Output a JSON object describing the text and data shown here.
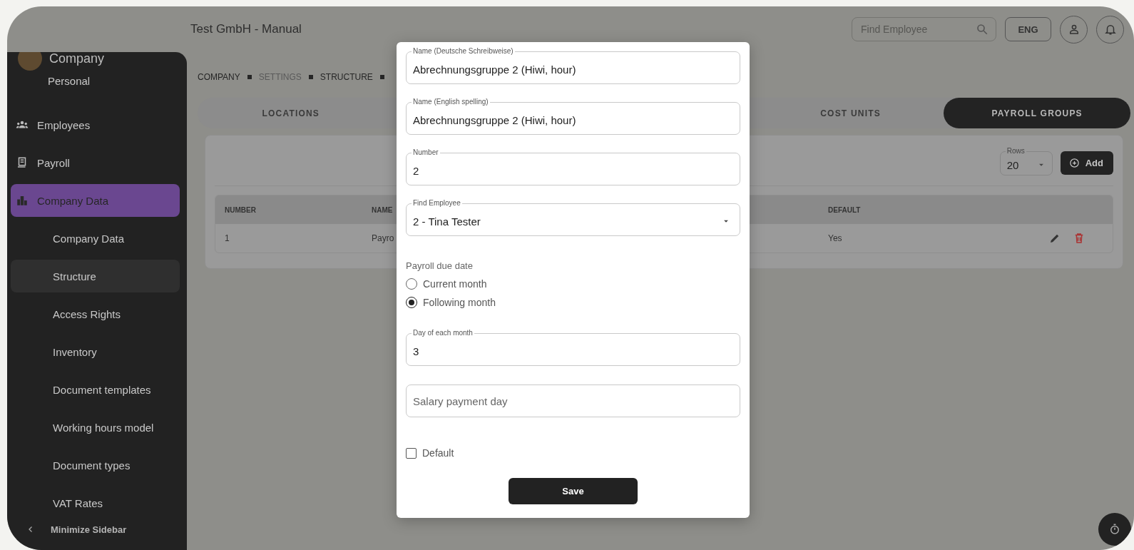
{
  "header": {
    "title": "Test GmbH - Manual",
    "search": {
      "placeholder": "Find Employee"
    },
    "language": "ENG"
  },
  "sidebar": {
    "account": {
      "name": "Company",
      "role": "Personal"
    },
    "items": [
      {
        "label": "Employees",
        "selected": false
      },
      {
        "label": "Payroll",
        "selected": false
      },
      {
        "label": "Company Data",
        "selected": true,
        "children": [
          {
            "label": "Company Data",
            "selected": false
          },
          {
            "label": "Structure",
            "selected": true
          },
          {
            "label": "Access Rights",
            "selected": false
          },
          {
            "label": "Inventory",
            "selected": false
          },
          {
            "label": "Document templates",
            "selected": false
          },
          {
            "label": "Working hours model",
            "selected": false
          },
          {
            "label": "Document types",
            "selected": false
          },
          {
            "label": "VAT Rates",
            "selected": false
          }
        ]
      }
    ],
    "footer": "Minimize Sidebar"
  },
  "breadcrumbs": [
    {
      "label": "COMPANY",
      "muted": false
    },
    {
      "label": "SETTINGS",
      "muted": true
    },
    {
      "label": "STRUCTURE",
      "muted": false
    }
  ],
  "tabs": [
    {
      "label": "LOCATIONS",
      "selected": false
    },
    {
      "label": "COST UNITS",
      "selected": false
    },
    {
      "label": "PAYROLL GROUPS",
      "selected": true
    }
  ],
  "rows_select": {
    "label": "Rows",
    "value": "20"
  },
  "add_button": "Add",
  "table": {
    "columns": [
      "NUMBER",
      "NAME",
      "DEFAULT"
    ],
    "rows": [
      [
        "1",
        "Payro",
        "Yes"
      ]
    ]
  },
  "dialog": {
    "fields": [
      {
        "kind": "text",
        "label": "Name (Deutsche Schreibweise)",
        "value": "Abrechnungsgruppe 2 (Hiwi, hour)"
      },
      {
        "kind": "text",
        "label": "Name (English spelling)",
        "value": "Abrechnungsgruppe 2 (Hiwi, hour)"
      },
      {
        "kind": "text",
        "label": "Number",
        "value": "2"
      },
      {
        "kind": "select",
        "label": "Find Employee",
        "value": "2 - Tina Tester"
      }
    ],
    "due_date": {
      "label": "Payroll due date",
      "options": [
        {
          "label": "Current month",
          "selected": false
        },
        {
          "label": "Following month",
          "selected": true
        }
      ]
    },
    "more_fields": [
      {
        "kind": "text",
        "label": "Day of each month",
        "value": "3"
      },
      {
        "kind": "text",
        "placeholder": "Salary payment day"
      }
    ],
    "default": {
      "label": "Default",
      "checked": false
    },
    "save": "Save"
  }
}
